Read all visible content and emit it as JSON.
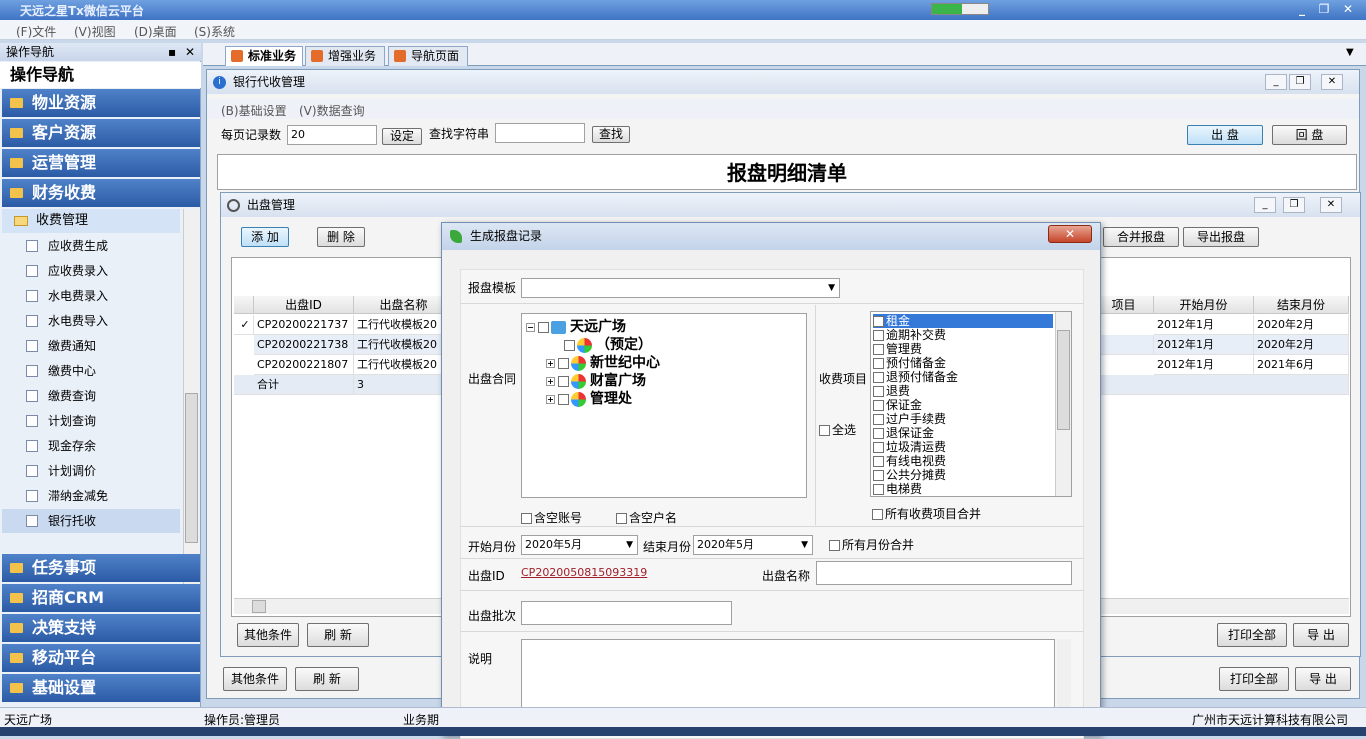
{
  "app": {
    "title": "天远之星Tx微信云平台"
  },
  "menubar": {
    "file": "(F)文件",
    "view": "(V)视图",
    "desktop": "(D)桌面",
    "system": "(S)系统"
  },
  "nav": {
    "header": "操作导航",
    "title": "操作导航",
    "categories_top": [
      "物业资源",
      "客户资源",
      "运营管理",
      "财务收费"
    ],
    "subcategory": "收费管理",
    "items": [
      "应收费生成",
      "应收费录入",
      "水电费录入",
      "水电费导入",
      "缴费通知",
      "缴费中心",
      "缴费查询",
      "计划查询",
      "现金存余",
      "计划调价",
      "滞纳金减免",
      "银行托收"
    ],
    "categories_bottom": [
      "任务事项",
      "招商CRM",
      "决策支持",
      "移动平台",
      "基础设置"
    ]
  },
  "tabs": [
    "标准业务",
    "增强业务",
    "导航页面"
  ],
  "bank_window": {
    "title": "银行代收管理",
    "menu": [
      "(B)基础设置",
      "(V)数据查询"
    ],
    "per_page_label": "每页记录数",
    "per_page_value": "20",
    "set_btn": "设定",
    "search_label": "查找字符串",
    "search_btn": "查找",
    "out_btn": "出 盘",
    "back_btn": "回 盘",
    "report_title": "报盘明细清单",
    "bottom_other": "其他条件",
    "bottom_refresh": "刷 新",
    "print_all": "打印全部",
    "export": "导 出"
  },
  "out_window": {
    "title": "出盘管理",
    "add_btn": "添 加",
    "delete_btn": "删 除",
    "merge_btn": "合并报盘",
    "export_btn": "导出报盘",
    "columns": [
      "出盘ID",
      "出盘名称",
      "项目",
      "开始月份",
      "结束月份"
    ],
    "rows": [
      {
        "id": "CP20200221737",
        "name": "工行代收模板20",
        "start": "2012年1月",
        "end": "2020年2月",
        "check": "✓"
      },
      {
        "id": "CP20200221738",
        "name": "工行代收模板20",
        "start": "2012年1月",
        "end": "2020年2月",
        "check": ""
      },
      {
        "id": "CP20200221807",
        "name": "工行代收模板20",
        "start": "2012年1月",
        "end": "2021年6月",
        "check": ""
      }
    ],
    "total_label": "合计",
    "total_value": "3",
    "other_btn": "其他条件",
    "refresh_btn": "刷 新",
    "print_all": "打印全部",
    "export": "导 出"
  },
  "dialog": {
    "title": "生成报盘记录",
    "template_label": "报盘模板",
    "contract_label": "出盘合同",
    "tree": [
      {
        "label": "天远广场",
        "level": 0
      },
      {
        "label": "（预定）",
        "level": 1
      },
      {
        "label": "新世纪中心",
        "level": 1
      },
      {
        "label": "财富广场",
        "level": 1
      },
      {
        "label": "管理处",
        "level": 1
      }
    ],
    "empty_account": "含空账号",
    "empty_name": "含空户名",
    "fee_label": "收费项目",
    "select_all": "全选",
    "fees": [
      "租金",
      "逾期补交费",
      "管理费",
      "预付储备金",
      "退预付储备金",
      "退费",
      "保证金",
      "过户手续费",
      "退保证金",
      "垃圾清运费",
      "有线电视费",
      "公共分摊费",
      "电梯费"
    ],
    "merge_all_fees": "所有收费项目合并",
    "start_label": "开始月份",
    "start_value": "2020年5月",
    "end_label": "结束月份",
    "end_value": "2020年5月",
    "merge_months": "所有月份合并",
    "id_label": "出盘ID",
    "id_value": "CP2020050815093319",
    "name_label": "出盘名称",
    "batch_label": "出盘批次",
    "note_label": "说明"
  },
  "status": {
    "site": "天远广场",
    "operator": "操作员:管理员",
    "business": "业务期",
    "company": "广州市天远计算科技有限公司"
  }
}
